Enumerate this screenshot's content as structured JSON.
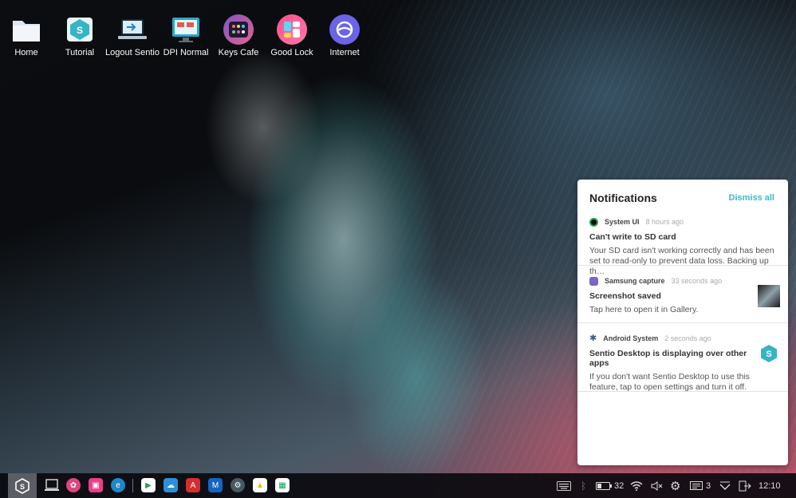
{
  "desktop": {
    "icons": [
      {
        "label": "Home",
        "icon": "folder-icon"
      },
      {
        "label": "Tutorial",
        "icon": "sentio-book-icon"
      },
      {
        "label": "Logout Sentio",
        "icon": "logout-laptop-icon"
      },
      {
        "label": "DPI Normal",
        "icon": "dpi-monitor-icon"
      },
      {
        "label": "Keys Cafe",
        "icon": "keys-cafe-icon"
      },
      {
        "label": "Good Lock",
        "icon": "good-lock-icon"
      },
      {
        "label": "Internet",
        "icon": "internet-icon"
      }
    ]
  },
  "notifications": {
    "title": "Notifications",
    "dismiss_label": "Dismiss all",
    "items": [
      {
        "app": "System UI",
        "time": "8 hours ago",
        "title": "Can't write to SD card",
        "body": "Your SD card isn't working correctly and has been set to read-only to prevent data loss. Backing up th…",
        "icon_color": "#2e9e55"
      },
      {
        "app": "Samsung capture",
        "time": "33 seconds ago",
        "title": "Screenshot saved",
        "body": "Tap here to open it in Gallery.",
        "icon_color": "#7a63c9"
      },
      {
        "app": "Android System",
        "time": "2 seconds ago",
        "title": "Sentio Desktop is displaying over other apps",
        "body": "If you don't want Sentio Desktop to use this feature, tap to open settings and turn it off.",
        "icon_color": "#3a5a8a"
      }
    ]
  },
  "taskbar": {
    "apps": [
      "overview-icon",
      "blossom-app-icon",
      "galaxy-store-icon",
      "edge-icon",
      "play-store-icon",
      "cloud-icon",
      "acrobat-icon",
      "maps-m-icon",
      "settings-gear-icon",
      "drive-icon",
      "sheets-icon"
    ],
    "battery": "32",
    "message_count": "3",
    "clock": "12:10"
  },
  "colors": {
    "accent": "#3fb8c8",
    "taskbar": "#0a0a0e",
    "panel": "#ffffff"
  }
}
